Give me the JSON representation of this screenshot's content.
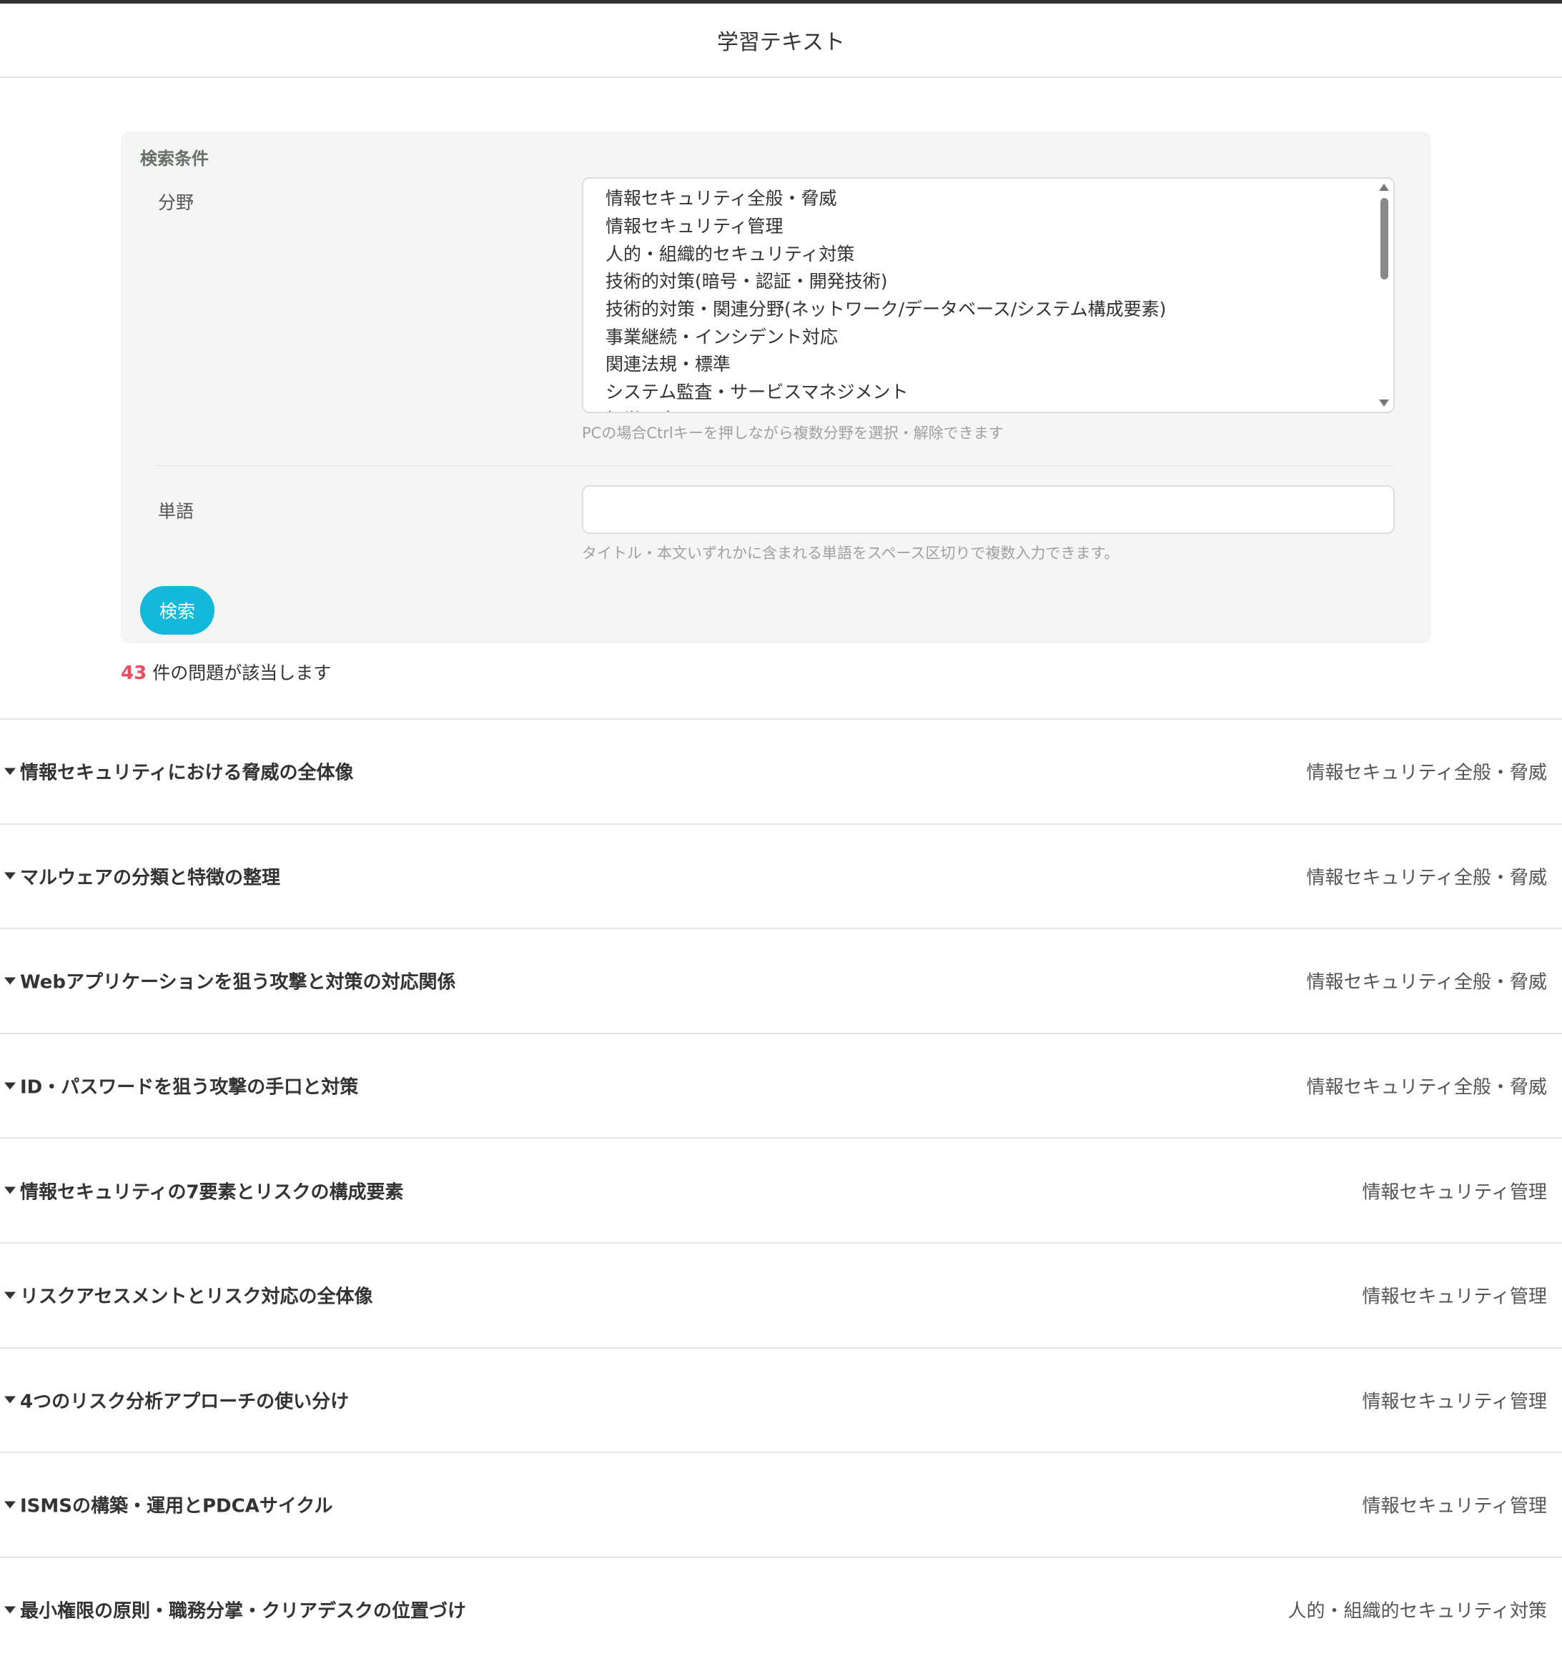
{
  "header": {
    "title": "学習テキスト"
  },
  "search": {
    "panel_title": "検索条件",
    "field_label": "分野",
    "field_options": [
      "情報セキュリティ全般・脅威",
      "情報セキュリティ管理",
      "人的・組織的セキュリティ対策",
      "技術的対策(暗号・認証・開発技術)",
      "技術的対策・関連分野(ネットワーク/データベース/システム構成要素)",
      "事業継続・インシデント対応",
      "関連法規・標準",
      "システム監査・サービスマネジメント",
      "経営・全て"
    ],
    "field_hint": "PCの場合Ctrlキーを押しながら複数分野を選択・解除できます",
    "word_label": "単語",
    "word_value": "",
    "word_hint": "タイトル・本文いずれかに含まれる単語をスペース区切りで複数入力できます。",
    "button_label": "検索"
  },
  "results": {
    "count": "43",
    "suffix": "件の問題が該当します",
    "items": [
      {
        "title": "情報セキュリティにおける脅威の全体像",
        "category": "情報セキュリティ全般・脅威"
      },
      {
        "title": "マルウェアの分類と特徴の整理",
        "category": "情報セキュリティ全般・脅威"
      },
      {
        "title": "Webアプリケーションを狙う攻撃と対策の対応関係",
        "category": "情報セキュリティ全般・脅威"
      },
      {
        "title": "ID・パスワードを狙う攻撃の手口と対策",
        "category": "情報セキュリティ全般・脅威"
      },
      {
        "title": "情報セキュリティの7要素とリスクの構成要素",
        "category": "情報セキュリティ管理"
      },
      {
        "title": "リスクアセスメントとリスク対応の全体像",
        "category": "情報セキュリティ管理"
      },
      {
        "title": "4つのリスク分析アプローチの使い分け",
        "category": "情報セキュリティ管理"
      },
      {
        "title": "ISMSの構築・運用とPDCAサイクル",
        "category": "情報セキュリティ管理"
      },
      {
        "title": "最小権限の原則・職務分掌・クリアデスクの位置づけ",
        "category": "人的・組織的セキュリティ対策"
      }
    ]
  }
}
